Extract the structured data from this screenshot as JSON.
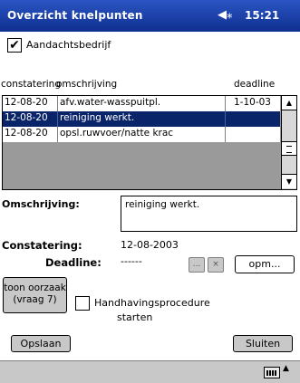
{
  "titlebar": {
    "title": "Overzicht knelpunten",
    "speaker_icon": "speaker-icon",
    "time": "15:21"
  },
  "aandachtsbedrijf": {
    "label": "Aandachtsbedrijf",
    "checked": true
  },
  "grid": {
    "columns": [
      "constatering",
      "omschrijving",
      "deadline"
    ],
    "rows": [
      {
        "constatering": "12-08-20",
        "omschrijving": "afv.water-wasspuitpl.",
        "deadline": "1-10-03",
        "selected": false
      },
      {
        "constatering": "12-08-20",
        "omschrijving": "reiniging werkt.",
        "deadline": "",
        "selected": true
      },
      {
        "constatering": "12-08-20",
        "omschrijving": "opsl.ruwvoer/natte krac",
        "deadline": "",
        "selected": false
      }
    ]
  },
  "detail": {
    "omschrijving_label": "Omschrijving:",
    "omschrijving_value": "reiniging werkt.",
    "constatering_label": "Constatering:",
    "constatering_value": "12-08-2003",
    "deadline_label": "Deadline:",
    "deadline_value": "------",
    "opm_button": "opm...",
    "ellipsis_button": "..."
  },
  "toon_oorzaak": {
    "line1": "toon oorzaak",
    "line2": "(vraag 7)"
  },
  "handhaving": {
    "line1": "Handhavingsprocedure",
    "line2": "starten",
    "checked": false
  },
  "buttons": {
    "opslaan": "Opslaan",
    "sluiten": "Sluiten"
  },
  "colors": {
    "titlebar": "#1a3fa8",
    "selection": "#0a246a",
    "grid_bg": "#9a9a9a"
  }
}
